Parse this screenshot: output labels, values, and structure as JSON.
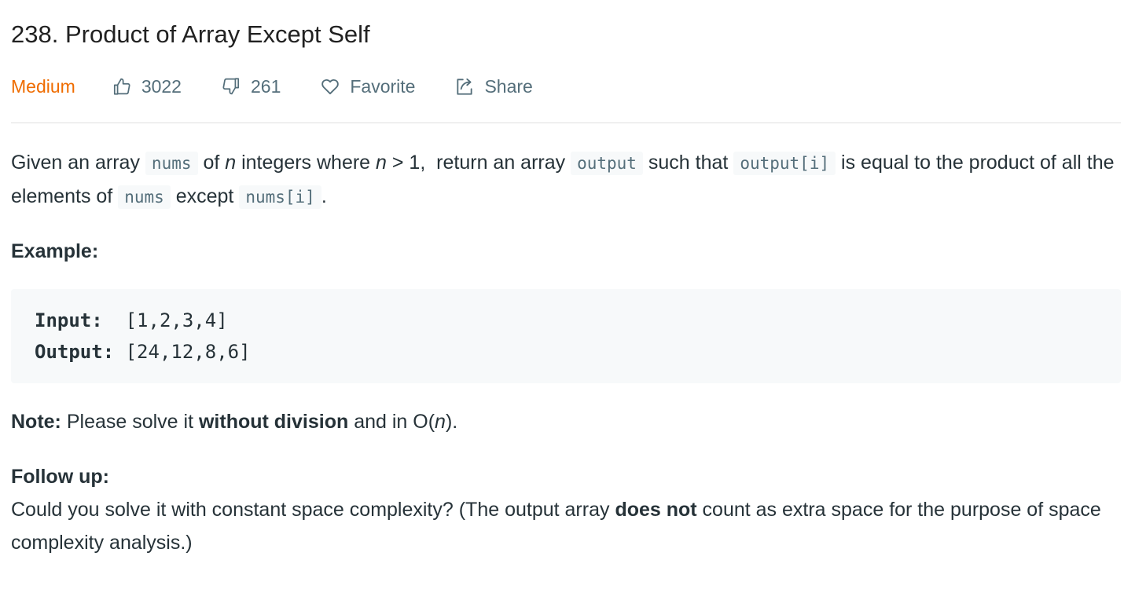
{
  "problem": {
    "title": "238. Product of Array Except Self",
    "difficulty": "Medium",
    "likes": "3022",
    "dislikes": "261",
    "favorite_label": "Favorite",
    "share_label": "Share"
  },
  "description": {
    "p1": {
      "t1": "Given an array ",
      "c1": "nums",
      "t2": " of ",
      "n1": "n",
      "t3": " integers where ",
      "n2": "n",
      "t4": " > 1,  return an array ",
      "c2": "output",
      "t5": " such that ",
      "c3": "output[i]",
      "t6": " is equal to the product of all the elements of ",
      "c4": "nums",
      "t7": " except ",
      "c5": "nums[i]",
      "t8": "."
    },
    "example_heading": "Example:",
    "example": {
      "input_label": "Input: ",
      "input_value": " [1,2,3,4]",
      "output_label": "Output:",
      "output_value": " [24,12,8,6]"
    },
    "note": {
      "label": "Note:",
      "t1": " Please solve it ",
      "bold": "without division",
      "t2": " and in O(",
      "n": "n",
      "t3": ")."
    },
    "follow_up": {
      "heading": "Follow up:",
      "t1": "Could you solve it with constant space complexity? (The output array ",
      "bold": "does not",
      "t2": " count as extra space for the purpose of space complexity analysis.)"
    }
  },
  "colors": {
    "difficulty_medium": "#ef6c00",
    "text": "#263238",
    "muted": "#546e7a",
    "code_bg": "#f7f9fa",
    "divider": "#e0e0e0"
  },
  "icons": {
    "like": "thumbs-up-icon",
    "dislike": "thumbs-down-icon",
    "favorite": "heart-icon",
    "share": "share-icon"
  }
}
